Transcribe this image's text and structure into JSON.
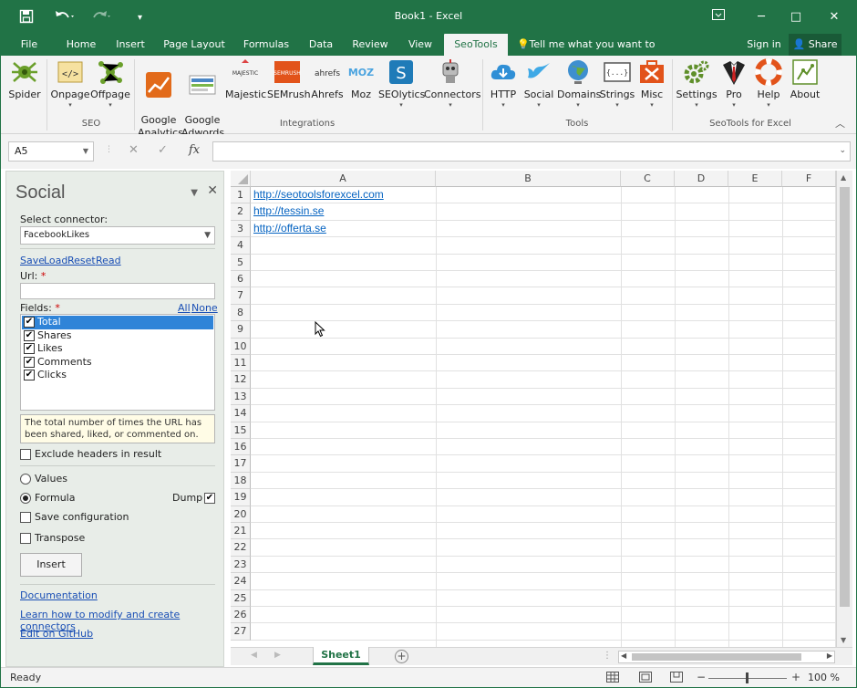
{
  "app": {
    "title": "Book1 - Excel"
  },
  "colors": {
    "accent": "#217346",
    "link": "#0563c1",
    "selection": "#2f84d8"
  },
  "qat": {
    "save_icon": "save-icon",
    "undo_icon": "undo-icon",
    "redo_icon": "redo-icon",
    "customize": "▾"
  },
  "window": {
    "restore_icon": "ribbon-display-icon",
    "minimize": "─",
    "maximize": "□",
    "close": "✕"
  },
  "tabs": [
    "File",
    "Home",
    "Insert",
    "Page Layout",
    "Formulas",
    "Data",
    "Review",
    "View",
    "SeoTools"
  ],
  "active_tab": "SeoTools",
  "tell_me": "Tell me what you want to do",
  "signin": "Sign in",
  "share": "Share",
  "ribbon": {
    "groups": [
      "SEO",
      "Integrations",
      "Tools",
      "SeoTools for Excel"
    ],
    "buttons": [
      {
        "label": "Spider",
        "icon": "spider-icon"
      },
      {
        "label": "Onpage",
        "icon": "onpage-icon"
      },
      {
        "label": "Offpage",
        "icon": "offpage-icon"
      },
      {
        "label": "Google\nAnalytics",
        "icon": "google-analytics-icon"
      },
      {
        "label": "Google\nAdwords",
        "icon": "google-adwords-icon"
      },
      {
        "label": "Majestic",
        "icon": "majestic-icon"
      },
      {
        "label": "SEMrush",
        "icon": "semrush-icon"
      },
      {
        "label": "Ahrefs",
        "icon": "ahrefs-icon"
      },
      {
        "label": "Moz",
        "icon": "moz-icon"
      },
      {
        "label": "SEOlytics",
        "icon": "seolytics-icon"
      },
      {
        "label": "Connectors",
        "icon": "connectors-icon"
      },
      {
        "label": "HTTP",
        "icon": "cloud-icon"
      },
      {
        "label": "Social",
        "icon": "social-icon"
      },
      {
        "label": "Domains",
        "icon": "globe-icon"
      },
      {
        "label": "Strings",
        "icon": "strings-icon"
      },
      {
        "label": "Misc",
        "icon": "misc-icon"
      },
      {
        "label": "Settings",
        "icon": "gear-icon"
      },
      {
        "label": "Pro",
        "icon": "pro-icon"
      },
      {
        "label": "Help",
        "icon": "lifebuoy-icon"
      },
      {
        "label": "About",
        "icon": "about-icon"
      }
    ]
  },
  "formula_bar": {
    "name_box": "A5",
    "cancel": "✕",
    "enter": "✓",
    "fx": "fx",
    "value": ""
  },
  "pane": {
    "title": "Social",
    "select_connector_label": "Select connector:",
    "connector_value": "FacebookLikes",
    "actions": [
      "Save",
      "Load",
      "Reset",
      "Read"
    ],
    "url_label": "Url:",
    "required_mark": "*",
    "fields_label": "Fields:",
    "all_link": "All",
    "none_link": "None",
    "fields": [
      "Total",
      "Shares",
      "Likes",
      "Comments",
      "Clicks"
    ],
    "tooltip": "The total number of times the URL has been shared, liked, or commented on.",
    "exclude_headers": "Exclude headers in result",
    "values_option": "Values",
    "formula_option": "Formula",
    "dump_label": "Dump",
    "save_configuration": "Save configuration",
    "transpose": "Transpose",
    "insert_button": "Insert",
    "links": [
      "Documentation",
      "Learn how to modify and create connectors",
      "Edit on GitHub"
    ]
  },
  "sheet": {
    "columns": [
      "A",
      "B",
      "C",
      "D",
      "E",
      "F"
    ],
    "rows": [
      "1",
      "2",
      "3",
      "4",
      "5",
      "6",
      "7",
      "8",
      "9",
      "10",
      "11",
      "12",
      "13",
      "14",
      "15",
      "16",
      "17",
      "18",
      "19",
      "20",
      "21",
      "22",
      "23",
      "24",
      "25",
      "26",
      "27"
    ],
    "cells": [
      "http://seotoolsforexcel.com",
      "http://tessin.se",
      "http://offerta.se"
    ],
    "active_cell": "A5"
  },
  "sheet_tab": "Sheet1",
  "status": {
    "ready": "Ready",
    "zoom": "100 %"
  }
}
